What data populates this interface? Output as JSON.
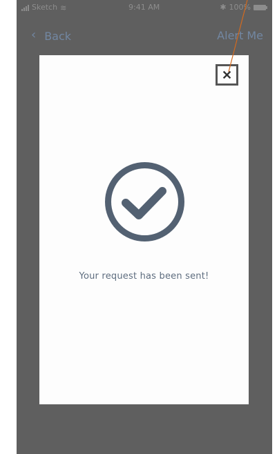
{
  "status_bar": {
    "carrier": "Sketch",
    "time": "9:41 AM",
    "battery": "100%"
  },
  "nav": {
    "back_label": "Back",
    "alert_label": "Alert Me"
  },
  "modal": {
    "message": "Your request has been sent!"
  },
  "icons": {
    "back": "chevron-left-icon",
    "close": "close-icon",
    "success": "check-circle-icon",
    "wifi": "wifi-icon",
    "battery": "battery-icon",
    "signal": "signal-icon"
  },
  "colors": {
    "overlay": "#5f5f5f",
    "modal_background": "#fdfdfd",
    "accent": "#7287a2",
    "success_icon": "#536172",
    "annotation": "#d46a1e"
  }
}
